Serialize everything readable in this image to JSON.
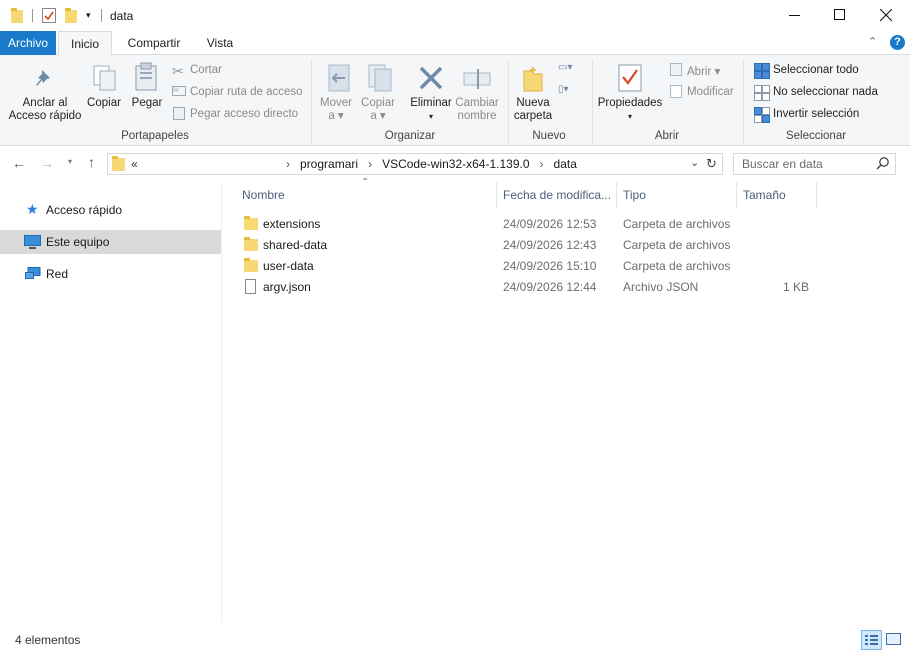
{
  "window": {
    "title": "data",
    "controls": {
      "minimize": "—",
      "maximize": "☐",
      "close": "✕"
    }
  },
  "ribbon_tabs": {
    "archivo": "Archivo",
    "inicio": "Inicio",
    "compartir": "Compartir",
    "vista": "Vista"
  },
  "ribbon": {
    "portapapeles": {
      "label": "Portapapeles",
      "anclar": [
        "Anclar al",
        "Acceso rápido"
      ],
      "copiar": "Copiar",
      "pegar": "Pegar",
      "cortar": "Cortar",
      "copiar_ruta": "Copiar ruta de acceso",
      "pegar_acceso": "Pegar acceso directo"
    },
    "organizar": {
      "label": "Organizar",
      "mover": [
        "Mover",
        "a"
      ],
      "copiar_a": [
        "Copiar",
        "a"
      ],
      "eliminar": "Eliminar",
      "cambiar_nombre": [
        "Cambiar",
        "nombre"
      ]
    },
    "nuevo": {
      "label": "Nuevo",
      "nueva_carpeta": [
        "Nueva",
        "carpeta"
      ]
    },
    "abrir": {
      "label": "Abrir",
      "propiedades": "Propiedades",
      "abrir": "Abrir",
      "modificar": "Modificar"
    },
    "seleccionar": {
      "label": "Seleccionar",
      "todo": "Seleccionar todo",
      "nada": "No seleccionar nada",
      "invertir": "Invertir selección"
    }
  },
  "address": {
    "overflow": "«",
    "crumbs": [
      "programari",
      "VSCode-win32-x64-1.139.0",
      "data"
    ],
    "search_placeholder": "Buscar en data"
  },
  "nav": {
    "items": [
      {
        "label": "Acceso rápido",
        "icon": "star-icon",
        "selected": false
      },
      {
        "label": "Este equipo",
        "icon": "computer-icon",
        "selected": true
      },
      {
        "label": "Red",
        "icon": "network-icon",
        "selected": false
      }
    ]
  },
  "columns": {
    "name": "Nombre",
    "date": "Fecha de modifica...",
    "type": "Tipo",
    "size": "Tamaño"
  },
  "files": [
    {
      "name": "extensions",
      "date": "24/09/2026 12:53",
      "type": "Carpeta de archivos",
      "size": "",
      "icon": "folder-icon"
    },
    {
      "name": "shared-data",
      "date": "24/09/2026 12:43",
      "type": "Carpeta de archivos",
      "size": "",
      "icon": "folder-icon"
    },
    {
      "name": "user-data",
      "date": "24/09/2026 15:10",
      "type": "Carpeta de archivos",
      "size": "",
      "icon": "folder-icon"
    },
    {
      "name": "argv.json",
      "date": "24/09/2026 12:44",
      "type": "Archivo JSON",
      "size": "1 KB",
      "icon": "file-icon"
    }
  ],
  "status": {
    "count": "4 elementos"
  },
  "colors": {
    "accent": "#1979ca",
    "folder": "#f8d775",
    "selection": "#d9d9d9"
  }
}
